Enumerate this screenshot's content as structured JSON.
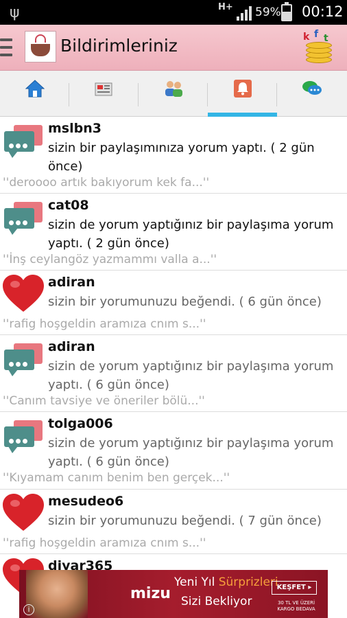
{
  "status_bar": {
    "network": "H+",
    "battery": "59%",
    "time": "00:12",
    "icons": [
      "usb-icon",
      "signal-icon",
      "battery-charging-icon"
    ]
  },
  "action_bar": {
    "title": "Bildirimleriniz",
    "logo_icon": "coffee-cup-logo",
    "right_icon": "coins-icon",
    "right_icon_letters": [
      "k",
      "f",
      "t"
    ]
  },
  "tabs": [
    {
      "icon": "home-icon",
      "active": false
    },
    {
      "icon": "news-icon",
      "active": false
    },
    {
      "icon": "friends-icon",
      "active": false
    },
    {
      "icon": "bell-icon",
      "active": true
    },
    {
      "icon": "chat-icon",
      "active": false
    }
  ],
  "notifications": [
    {
      "icon": "comment-icon",
      "user": "mslbn3",
      "message": "sizin bir paylaşımınıza yorum yaptı. ( 2 gün önce)",
      "quote": "''deroooo artık bakıyorum kek fa...''",
      "unread": true
    },
    {
      "icon": "comment-icon",
      "user": "cat08",
      "message": " sizin de yorum yaptığınız bir paylaşıma yorum yaptı. ( 2 gün  önce)",
      "quote": "''İnş ceylangöz yazmammı valla a...''",
      "unread": true
    },
    {
      "icon": "heart-icon",
      "user": "adiran",
      "message": "sizin bir yorumunuzu beğendi. ( 6 gün  önce)",
      "quote": "''rafig hoşgeldin aramıza cnım s...''",
      "unread": false
    },
    {
      "icon": "comment-icon",
      "user": "adiran",
      "message": " sizin de yorum yaptığınız bir paylaşıma yorum yaptı. ( 6 gün  önce)",
      "quote": "''Canım tavsiye ve öneriler bölü...''",
      "unread": false
    },
    {
      "icon": "comment-icon",
      "user": "tolga006",
      "message": " sizin de yorum yaptığınız bir paylaşıma yorum yaptı. ( 6 gün  önce)",
      "quote": "''Kıyamam canım benim ben gerçek...''",
      "unread": false
    },
    {
      "icon": "heart-icon",
      "user": "mesudeo6",
      "message": "sizin bir yorumunuzu beğendi. ( 7 gün  önce)",
      "quote": "''rafig hoşgeldin aramıza cnım s...''",
      "unread": false
    },
    {
      "icon": "heart-icon",
      "user": "diyar365",
      "message": "",
      "quote": "",
      "unread": false
    }
  ],
  "ad": {
    "brand": "mizu",
    "line1_a": "Yeni Yıl ",
    "line1_b": "Sürprizleri",
    "line2": "Sizi Bekliyor",
    "button": "KEŞFET ▸",
    "small": "30 TL VE ÜZERİ KARGO BEDAVA",
    "info": "i",
    "colors": {
      "background": "#a51d2d",
      "highlight": "#f6a03b"
    }
  },
  "colors": {
    "action_bar": "#f1bcc5",
    "tab_active": "#33b5e5",
    "comment_bubble": "#4e8e8a",
    "heart": "#d8232a"
  }
}
